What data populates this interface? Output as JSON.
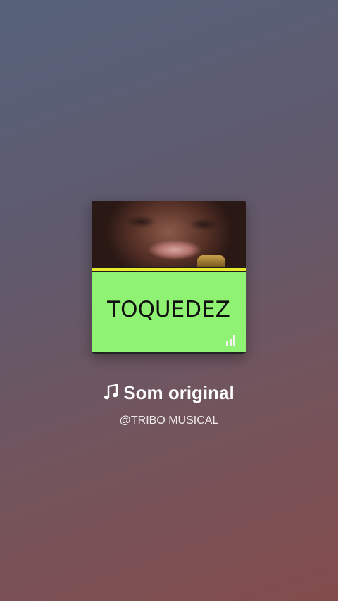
{
  "cover": {
    "text": "TOQUEDEZ",
    "colors": {
      "panel": "#8ff272",
      "stripe": "#e6ea2a"
    },
    "corner_icon": "signal-bars-icon"
  },
  "sound": {
    "icon": "music-note-icon",
    "title": "Som original",
    "author": "@TRIBO MUSICAL"
  }
}
